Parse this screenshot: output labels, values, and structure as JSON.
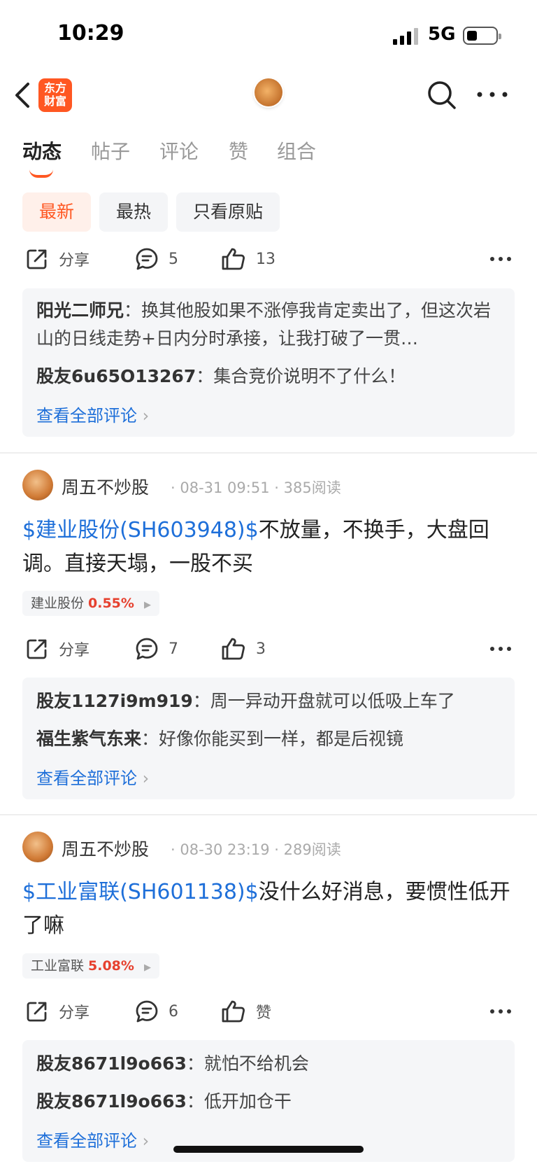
{
  "status": {
    "time": "10:29",
    "network": "5G"
  },
  "nav": {
    "logo_line1": "东方",
    "logo_line2": "财富"
  },
  "tabs": [
    "动态",
    "帖子",
    "评论",
    "赞",
    "组合"
  ],
  "filters": [
    "最新",
    "最热",
    "只看原贴"
  ],
  "post1": {
    "actions": {
      "share": "分享",
      "comments": "5",
      "likes": "13"
    },
    "comments": [
      {
        "user": "阳光二师兄",
        "text": "换其他股如果不涨停我肯定卖出了，但这次岩山的日线走势+日内分时承接，让我打破了一贯…"
      },
      {
        "user": "股友6u65O13267",
        "text": "集合竞价说明不了什么！"
      }
    ],
    "view_all": "查看全部评论"
  },
  "post2": {
    "author": "周五不炒股",
    "time": "08-31 09:51",
    "reads": "385阅读",
    "stock_link": "$建业股份(SH603948)$",
    "body": "不放量，不换手，大盘回调。直接天塌，一股不买",
    "tag_name": "建业股份",
    "tag_pct": "0.55%",
    "actions": {
      "share": "分享",
      "comments": "7",
      "likes": "3"
    },
    "comments": [
      {
        "user": "股友1127i9m919",
        "text": "周一异动开盘就可以低吸上车了"
      },
      {
        "user": "福生紫气东来",
        "text": "好像你能买到一样，都是后视镜"
      }
    ],
    "view_all": "查看全部评论"
  },
  "post3": {
    "author": "周五不炒股",
    "time": "08-30 23:19",
    "reads": "289阅读",
    "stock_link": "$工业富联(SH601138)$",
    "body": "没什么好消息，要惯性低开了嘛",
    "tag_name": "工业富联",
    "tag_pct": "5.08%",
    "actions": {
      "share": "分享",
      "comments": "6",
      "likes": "赞"
    },
    "comments": [
      {
        "user": "股友8671l9o663",
        "text": "就怕不给机会"
      },
      {
        "user": "股友8671l9o663",
        "text": "低开加仓干"
      }
    ],
    "view_all": "查看全部评论"
  },
  "colors": {
    "accent": "#ff5722",
    "link": "#1e6fd9",
    "rise": "#e6412f"
  }
}
